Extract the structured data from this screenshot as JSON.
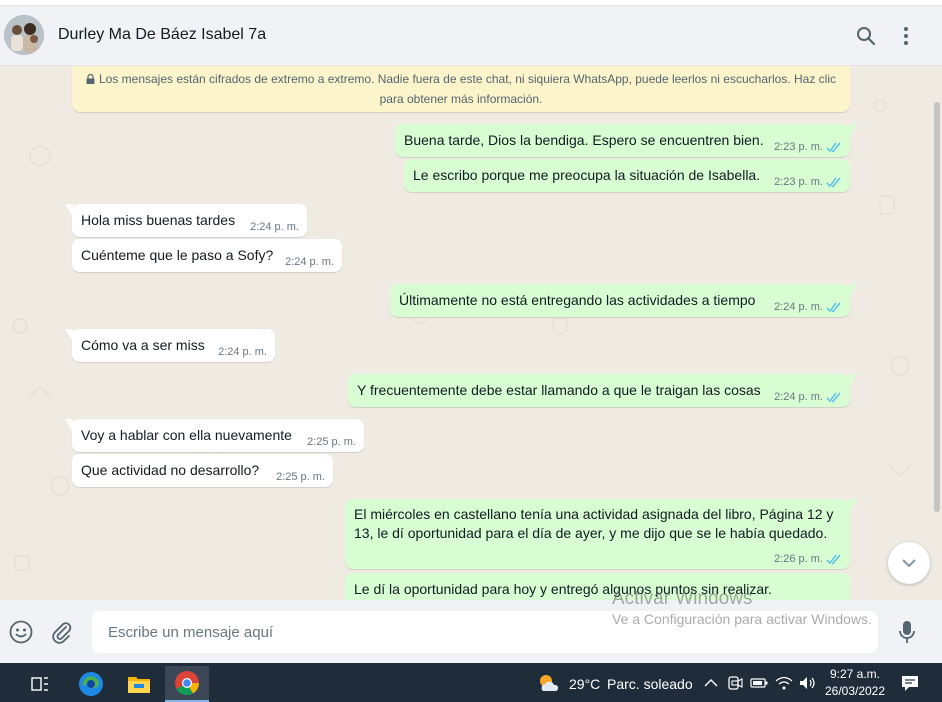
{
  "header": {
    "contact_name": "Durley Ma De Báez Isabel 7a",
    "search_icon": "search-icon",
    "menu_icon": "menu-dots-icon"
  },
  "encryption_notice": "Los mensajes están cifrados de extremo a extremo. Nadie fuera de este chat, ni siquiera WhatsApp, puede leerlos ni escucharlos. Haz clic para obtener más información.",
  "messages": [
    {
      "dir": "out",
      "text": "Buena tarde, Dios la bendiga. Espero se encuentren bien.",
      "time": "2:23 p. m."
    },
    {
      "dir": "out",
      "text": "Le escribo porque me preocupa la situación de Isabella.",
      "time": "2:23 p. m."
    },
    {
      "dir": "in",
      "text": "Hola miss buenas tardes",
      "time": "2:24 p. m."
    },
    {
      "dir": "in",
      "text": "Cuénteme que le paso a Sofy?",
      "time": "2:24 p. m."
    },
    {
      "dir": "out",
      "text": "Últimamente no está entregando las actividades a tiempo",
      "time": "2:24 p. m."
    },
    {
      "dir": "in",
      "text": "Cómo va a ser miss",
      "time": "2:24 p. m."
    },
    {
      "dir": "out",
      "text": "Y frecuentemente debe estar llamando a que le traigan las cosas",
      "time": "2:24 p. m."
    },
    {
      "dir": "in",
      "text": "Voy a hablar con ella nuevamente",
      "time": "2:25 p. m."
    },
    {
      "dir": "in",
      "text": "Que actividad no desarrollo?",
      "time": "2:25 p. m."
    },
    {
      "dir": "out",
      "text": "El miércoles en castellano tenía una actividad asignada del libro, Página 12 y 13, le dí oportunidad para el día de ayer, y me dijo que se le había quedado.",
      "time": "2:26 p. m."
    },
    {
      "dir": "out",
      "text": "Le dí la oportunidad para hoy y entregó algunos puntos sin realizar.",
      "time": ""
    }
  ],
  "composer": {
    "placeholder": "Escribe un mensaje aquí",
    "emoji_icon": "emoji-icon",
    "attach_icon": "attach-icon",
    "mic_icon": "mic-icon"
  },
  "watermark": {
    "line1": "Activar Windows",
    "line2": "Ve a Configuración para activar Windows."
  },
  "taskbar": {
    "weather_temp": "29°C",
    "weather_desc": "Parc. soleado",
    "time": "9:27 a.m.",
    "date": "26/03/2022"
  },
  "colors": {
    "outgoing_bubble": "#d9fdd3",
    "incoming_bubble": "#ffffff",
    "read_tick": "#53bdeb",
    "notice_bg": "#fcf4cb",
    "taskbar_bg": "#1f2c3a"
  }
}
